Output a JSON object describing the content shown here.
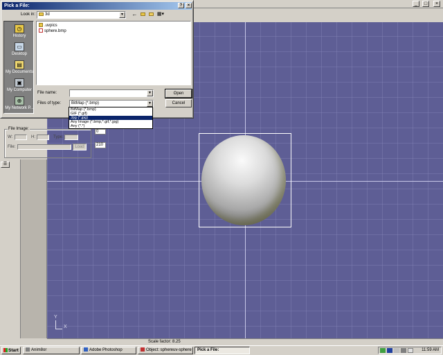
{
  "dialog": {
    "title": "Pick a File:",
    "look_in_label": "Look in:",
    "look_in_value": "3d",
    "places": [
      {
        "label": "History",
        "icon": "history-icon"
      },
      {
        "label": "Desktop",
        "icon": "desktop-icon"
      },
      {
        "label": "My Documents",
        "icon": "my-documents-icon"
      },
      {
        "label": "My Computer",
        "icon": "my-computer-icon"
      },
      {
        "label": "My Network P...",
        "icon": "network-places-icon"
      }
    ],
    "files": [
      {
        "name": ".uvpics",
        "icon": "folder-icon"
      },
      {
        "name": "sphere.bmp",
        "icon": "bitmap-file-icon"
      }
    ],
    "file_name_label": "File name:",
    "file_name_value": "",
    "files_of_type_label": "Files of type:",
    "files_of_type_value": "BitMap (*.bmp)",
    "type_options": [
      "BitMap (*.bmp)",
      "GIF (*.gif)",
      "Jpg (*.jpg)",
      "Any Image (*.bmp,*.gif,*.jpg)",
      "Any (*.*)"
    ],
    "type_selected_index": 2,
    "open_label": "Open",
    "cancel_label": "Cancel"
  },
  "side_panel": {
    "file_image_group": "File Image:",
    "w_label": "W:",
    "h_label": "H:",
    "type_label": "Type:",
    "file_label": "File:",
    "load_label": "Load",
    "value_1": "0",
    "value_2": "210"
  },
  "viewport": {
    "axis_y": "Y",
    "axis_x": "X",
    "status": "Scale factor: 8.25",
    "background_color": "#5e5e95"
  },
  "taskbar": {
    "start_label": "Start",
    "tasks": [
      {
        "label": "Anim8or",
        "icon": "anim8or-icon"
      },
      {
        "label": "Adobe Photoshop",
        "icon": "photoshop-icon"
      },
      {
        "label": "Object: sphereuv-sphere",
        "icon": "anim8or-object-icon"
      },
      {
        "label": "Pick a File:",
        "icon": ""
      }
    ],
    "clock": "11:59 AM"
  }
}
